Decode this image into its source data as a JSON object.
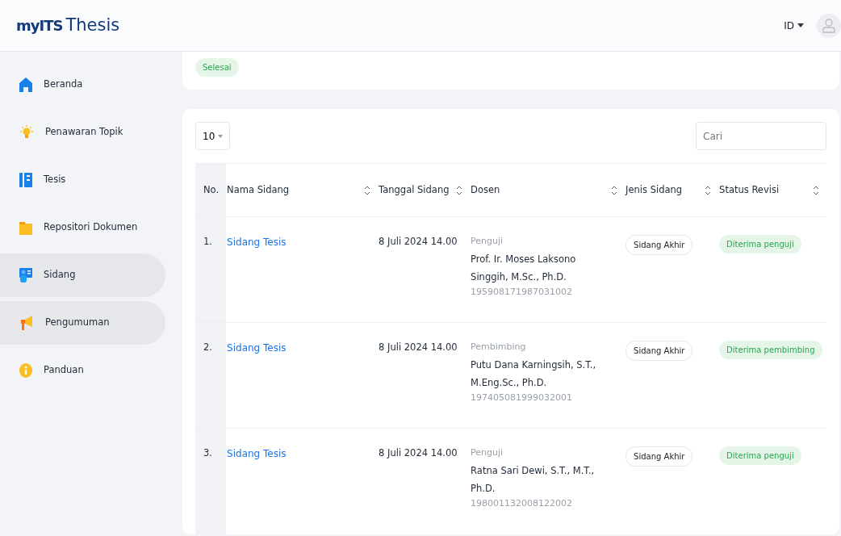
{
  "header": {
    "logo_prefix": "myITS",
    "logo_title": "Thesis",
    "language": "ID"
  },
  "sidebar": {
    "items": [
      {
        "label": "Beranda",
        "highlighted": false
      },
      {
        "label": "Penawaran Topik",
        "highlighted": false
      },
      {
        "label": "Tesis",
        "highlighted": false
      },
      {
        "label": "Repositori Dokumen",
        "highlighted": false
      },
      {
        "label": "Sidang",
        "highlighted": true
      },
      {
        "label": "Pengumuman",
        "highlighted": true
      },
      {
        "label": "Panduan",
        "highlighted": false
      }
    ]
  },
  "status_card": {
    "badge": "Selesai"
  },
  "table_controls": {
    "page_size": "10",
    "search": {
      "placeholder": "Cari"
    }
  },
  "table": {
    "columns": [
      {
        "label": "No.",
        "sortable": false
      },
      {
        "label": "Nama Sidang",
        "sortable": true
      },
      {
        "label": "Tanggal Sidang",
        "sortable": true
      },
      {
        "label": "Dosen",
        "sortable": true
      },
      {
        "label": "Jenis Sidang",
        "sortable": true
      },
      {
        "label": "Status Revisi",
        "sortable": true
      }
    ],
    "rows": [
      {
        "no": "1.",
        "name": "Sidang Tesis",
        "date": "8 Juli 2024 14.00",
        "role": "Penguji",
        "lecturer": "Prof. Ir. Moses Laksono Singgih, M.Sc., Ph.D.",
        "nip": "195908171987031002",
        "type": "Sidang Akhir",
        "status": "Diterima penguji"
      },
      {
        "no": "2.",
        "name": "Sidang Tesis",
        "date": "8 Juli 2024 14.00",
        "role": "Pembimbing",
        "lecturer": "Putu Dana Karningsih, S.T., M.Eng.Sc., Ph.D.",
        "nip": "197405081999032001",
        "type": "Sidang Akhir",
        "status": "Diterima pembimbing"
      },
      {
        "no": "3.",
        "name": "Sidang Tesis",
        "date": "8 Juli 2024 14.00",
        "role": "Penguji",
        "lecturer": "Ratna Sari Dewi, S.T., M.T., Ph.D.",
        "nip": "198001132008122002",
        "type": "Sidang Akhir",
        "status": "Diterima penguji"
      }
    ]
  }
}
